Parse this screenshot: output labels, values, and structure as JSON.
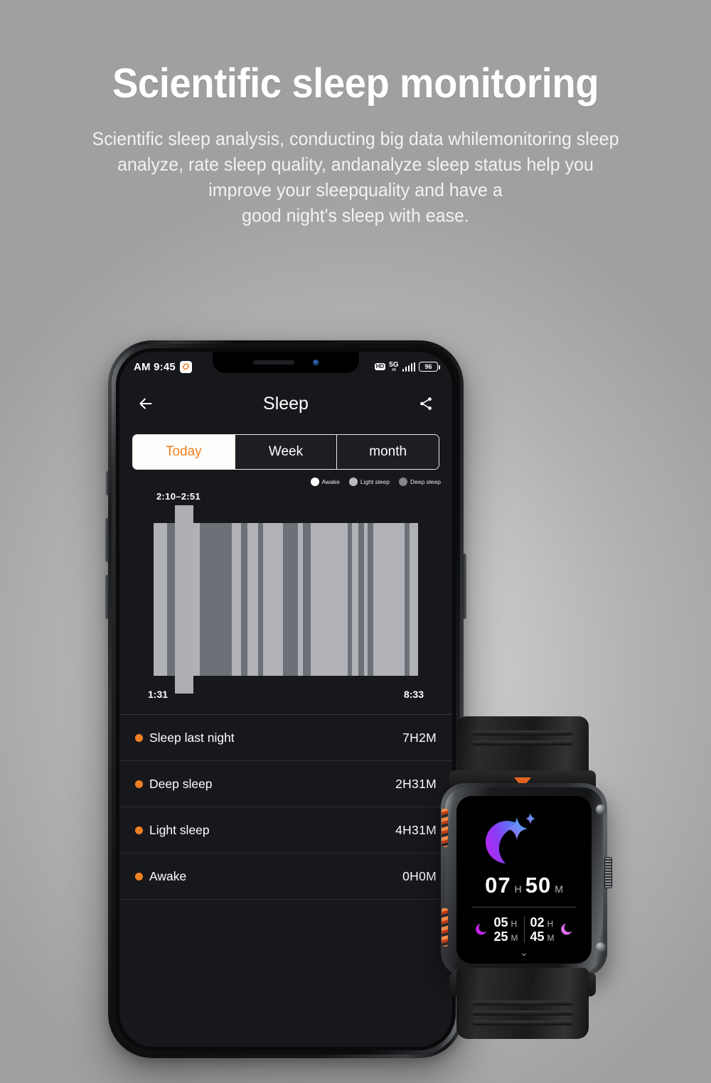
{
  "hero": {
    "title": "Scientific sleep monitoring",
    "subtitle_lines": [
      "Scientific sleep analysis, conducting big data whilemonitoring sleep",
      "analyze, rate sleep quality, andanalyze sleep status help you",
      "improve your sleepquality and have a",
      "good night's sleep with ease."
    ]
  },
  "phone": {
    "status_bar": {
      "time": "AM 9:45",
      "app_badge": "O",
      "hd_label": "HD",
      "network": "5G",
      "network_sub": "49",
      "battery_percent": "96"
    },
    "app_header": {
      "back_icon": "back-arrow-icon",
      "title": "Sleep",
      "share_icon": "share-icon"
    },
    "tabs": [
      {
        "label": "Today",
        "active": true
      },
      {
        "label": "Week",
        "active": false
      },
      {
        "label": "month",
        "active": false
      }
    ],
    "legend": [
      {
        "label": "Awake",
        "color": "#ffffff"
      },
      {
        "label": "Light sleep",
        "color": "#b9bbc0"
      },
      {
        "label": "Deep sleep",
        "color": "#83858b"
      }
    ],
    "stats": [
      {
        "label": "Sleep last night",
        "value": "7H2M"
      },
      {
        "label": "Deep sleep",
        "value": "2H31M"
      },
      {
        "label": "Light sleep",
        "value": "4H31M"
      },
      {
        "label": "Awake",
        "value": "0H0M"
      }
    ],
    "accent_color": "#f08123"
  },
  "watch": {
    "total_hours": "07",
    "total_hours_unit": "H",
    "total_minutes": "50",
    "total_minutes_unit": "M",
    "deep": {
      "hours": "05",
      "hours_unit": "H",
      "minutes": "25",
      "minutes_unit": "M"
    },
    "light": {
      "hours": "02",
      "hours_unit": "H",
      "minutes": "45",
      "minutes_unit": "M"
    },
    "chevron": "⌄",
    "moon_icon": "crescent-moon-icon"
  },
  "chart_data": {
    "type": "bar",
    "title": "Sleep stages timeline",
    "tooltip": "2:10–2:51",
    "xlabel": "",
    "ylabel": "",
    "x_start_label": "1:31",
    "x_end_label": "8:33",
    "legend": [
      "Awake",
      "Light sleep",
      "Deep sleep"
    ],
    "colors": {
      "awake": "#ffffff",
      "light": "#b0b2b8",
      "deep": "#6e7077",
      "selected": "#adaeb4"
    },
    "selected_segment": {
      "label": "2:10–2:51",
      "start_pct": 8.0,
      "width_pct": 7.0
    },
    "segments": [
      {
        "stage": "light",
        "start_pct": 0.0,
        "width_pct": 5.0
      },
      {
        "stage": "deep",
        "start_pct": 5.0,
        "width_pct": 8.0
      },
      {
        "stage": "light",
        "start_pct": 13.0,
        "width_pct": 4.5
      },
      {
        "stage": "deep",
        "start_pct": 17.5,
        "width_pct": 12.0
      },
      {
        "stage": "light",
        "start_pct": 29.5,
        "width_pct": 3.5
      },
      {
        "stage": "deep",
        "start_pct": 33.0,
        "width_pct": 2.5
      },
      {
        "stage": "light",
        "start_pct": 35.5,
        "width_pct": 4.0
      },
      {
        "stage": "deep",
        "start_pct": 39.5,
        "width_pct": 2.0
      },
      {
        "stage": "light",
        "start_pct": 41.5,
        "width_pct": 7.5
      },
      {
        "stage": "deep",
        "start_pct": 49.0,
        "width_pct": 5.5
      },
      {
        "stage": "light",
        "start_pct": 54.5,
        "width_pct": 2.0
      },
      {
        "stage": "deep",
        "start_pct": 56.5,
        "width_pct": 3.0
      },
      {
        "stage": "light",
        "start_pct": 59.5,
        "width_pct": 14.0
      },
      {
        "stage": "deep",
        "start_pct": 73.5,
        "width_pct": 1.5
      },
      {
        "stage": "light",
        "start_pct": 75.0,
        "width_pct": 2.5
      },
      {
        "stage": "deep",
        "start_pct": 77.5,
        "width_pct": 2.0
      },
      {
        "stage": "light",
        "start_pct": 79.5,
        "width_pct": 1.5
      },
      {
        "stage": "deep",
        "start_pct": 81.0,
        "width_pct": 2.0
      },
      {
        "stage": "light",
        "start_pct": 83.0,
        "width_pct": 12.0
      },
      {
        "stage": "deep",
        "start_pct": 95.0,
        "width_pct": 1.8
      },
      {
        "stage": "light",
        "start_pct": 96.8,
        "width_pct": 3.2
      }
    ]
  }
}
